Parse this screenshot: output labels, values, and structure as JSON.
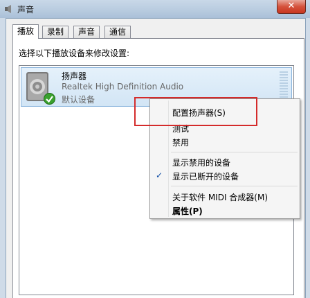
{
  "window": {
    "title": "声音",
    "close_label": "✕"
  },
  "tabs": [
    {
      "label": "播放",
      "active": true
    },
    {
      "label": "录制"
    },
    {
      "label": "声音"
    },
    {
      "label": "通信"
    }
  ],
  "panel": {
    "instruction": "选择以下播放设备来修改设置:"
  },
  "device": {
    "name": "扬声器",
    "description": "Realtek High Definition Audio",
    "status": "默认设备",
    "icon": "speaker-icon",
    "badge_icon": "default-check-icon"
  },
  "context_menu": {
    "items": [
      {
        "label": "配置扬声器(S)",
        "highlighted": true
      },
      {
        "label": "测试"
      },
      {
        "label": "禁用"
      },
      {
        "label": "显示禁用的设备"
      },
      {
        "label": "显示已断开的设备",
        "checked": true,
        "check_glyph": "✓"
      },
      {
        "label": "关于软件 MIDI 合成器(M)"
      },
      {
        "label": "属性(P)",
        "bold": true
      }
    ]
  },
  "colors": {
    "highlight_box": "#d42b2b",
    "selection": "#d2e5f5"
  }
}
